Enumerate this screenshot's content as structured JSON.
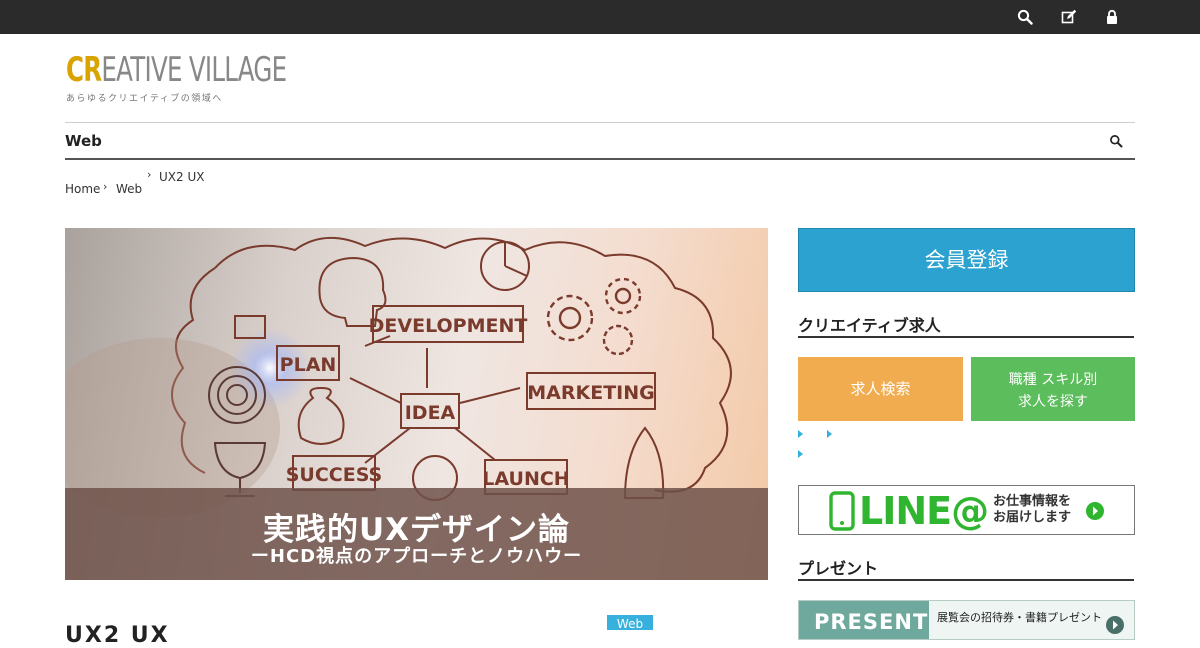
{
  "topbar": {
    "icons": [
      "search-icon",
      "edit-icon",
      "lock-icon"
    ],
    "background": "#2b2b2b"
  },
  "logo": {
    "accent": "CR",
    "rest": "EATIVE VILLAGE",
    "tagline": "あらゆるクリエイティブの領域へ",
    "accent_color": "#d9a300"
  },
  "category_bar": {
    "label": "Web"
  },
  "breadcrumb": {
    "home": "Home",
    "section": "Web",
    "current": "UX2 UX"
  },
  "hero": {
    "words": [
      "DEVELOPMENT",
      "PLAN",
      "IDEA",
      "MARKETING",
      "SUCCESS",
      "LAUNCH"
    ],
    "title": "実践的UXデザイン論",
    "subtitle": "ーHCD視点のアプローチとノウハウー"
  },
  "post": {
    "tag": "Web",
    "title_peek": "UX2 UX"
  },
  "sidebar": {
    "button_label": "会員登録",
    "section_title": "クリエイティブ求人",
    "orange_box": "求人検索",
    "green_box_line1": "職種 スキル別",
    "green_box_line2": "求人を探す",
    "line_banner": {
      "word": "LINE@",
      "text_line1": "お仕事情報を",
      "text_line2": "お届けします"
    },
    "present_title": "プレゼント",
    "present_banner": {
      "label": "PRESENT",
      "text": "展覧会の招待券・書籍プレゼント"
    },
    "colors": {
      "blue": "#2ba2cf",
      "orange": "#f0ac4e",
      "green": "#5bbd5b"
    }
  }
}
